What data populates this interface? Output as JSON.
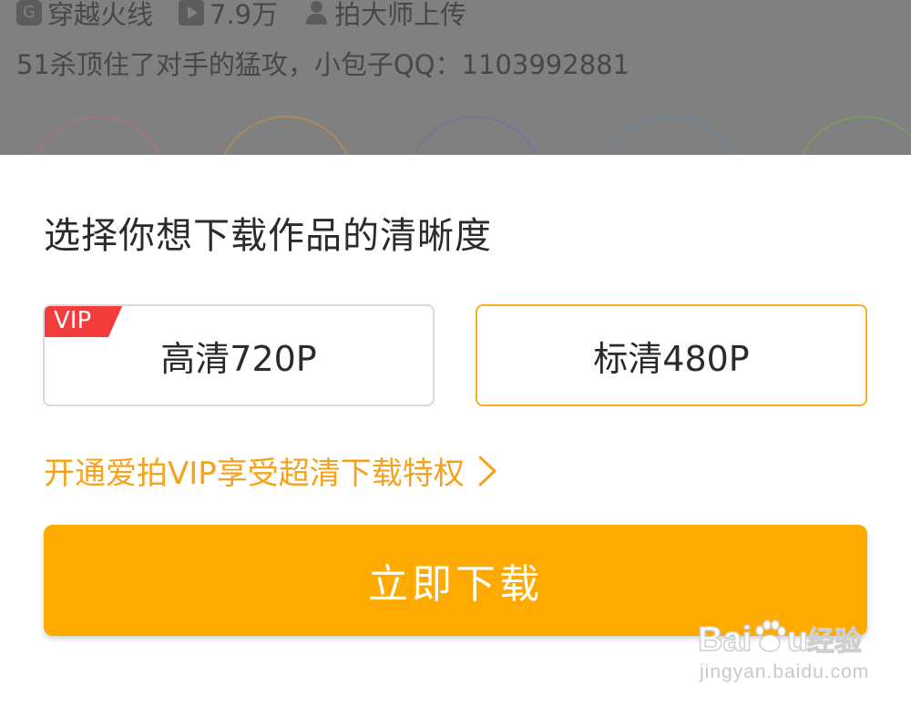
{
  "background": {
    "meta": {
      "game": "穿越火线",
      "views": "7.9万",
      "uploader": "拍大师上传"
    },
    "description": "51杀顶住了对手的猛攻，小包子QQ：1103992881",
    "share_circle_colors": [
      "#a0787c",
      "#a98a63",
      "#7a7298",
      "#6f8297",
      "#7e9768"
    ]
  },
  "sheet": {
    "title": "选择你想下载作品的清晰度",
    "options": [
      {
        "label": "高清720P",
        "badge": "VIP",
        "selected": false
      },
      {
        "label": "标清480P",
        "selected": true
      }
    ],
    "vip_promo": "开通爱拍VIP享受超清下载特权",
    "download_button": "立即下载"
  },
  "watermark": {
    "brand": "Baidu经验",
    "url": "jingyan.baidu.com"
  },
  "colors": {
    "accent": "#ffaa00",
    "selected_border": "#f6b01c",
    "promo_text": "#f6a21c",
    "vip_badge": "#f33c3c"
  }
}
